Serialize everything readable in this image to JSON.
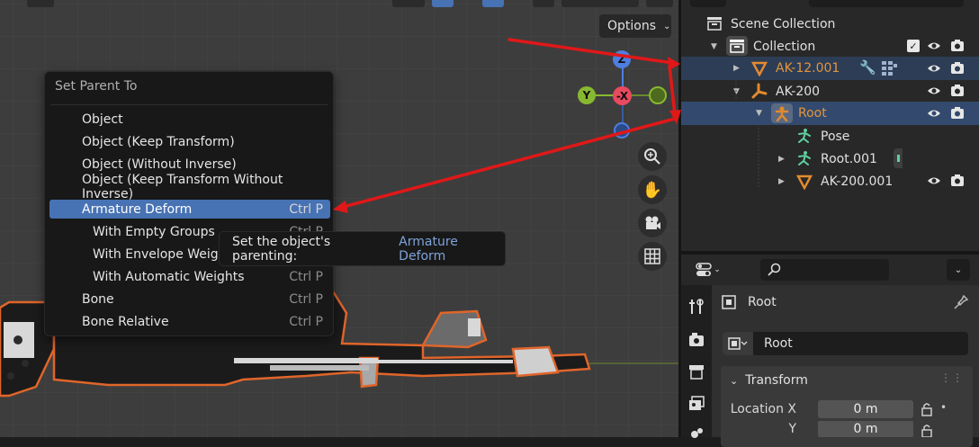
{
  "viewport": {
    "options_label": "Options",
    "gizmo": {
      "z": "Z",
      "y": "Y",
      "neg_x": "-X"
    }
  },
  "menu": {
    "title": "Set Parent To",
    "items": [
      {
        "label": "Object",
        "shortcut": "",
        "sub": false,
        "active": false
      },
      {
        "label": "Object (Keep Transform)",
        "shortcut": "",
        "sub": false,
        "active": false
      },
      {
        "label": "Object (Without Inverse)",
        "shortcut": "",
        "sub": false,
        "active": false
      },
      {
        "label": "Object (Keep Transform Without Inverse)",
        "shortcut": "",
        "sub": false,
        "active": false
      },
      {
        "label": "Armature Deform",
        "shortcut": "Ctrl P",
        "sub": false,
        "active": true
      },
      {
        "label": "With Empty Groups",
        "shortcut": "Ctrl P",
        "sub": true,
        "active": false
      },
      {
        "label": "With Envelope Weight",
        "shortcut": "",
        "sub": true,
        "active": false
      },
      {
        "label": "With Automatic Weights",
        "shortcut": "Ctrl P",
        "sub": true,
        "active": false
      },
      {
        "label": "Bone",
        "shortcut": "Ctrl P",
        "sub": false,
        "active": false
      },
      {
        "label": "Bone Relative",
        "shortcut": "Ctrl P",
        "sub": false,
        "active": false
      }
    ]
  },
  "tooltip": {
    "text": "Set the object's parenting:",
    "value": "Armature Deform"
  },
  "outliner": {
    "scene_collection": "Scene Collection",
    "rows": {
      "collection": "Collection",
      "ak12": "AK-12.001",
      "ak200": "AK-200",
      "root": "Root",
      "pose": "Pose",
      "root001": "Root.001",
      "ak200001": "AK-200.001"
    },
    "colors": {
      "selected_text": "#e5953a",
      "armature_orange": "#e38a2e",
      "bone_green": "#5fd0a0"
    }
  },
  "properties": {
    "object_name": "Root",
    "name_field": "Root",
    "transform_title": "Transform",
    "location_x_label": "Location X",
    "location_y_label": "Y",
    "location_x": "0 m",
    "location_y": "0 m"
  }
}
